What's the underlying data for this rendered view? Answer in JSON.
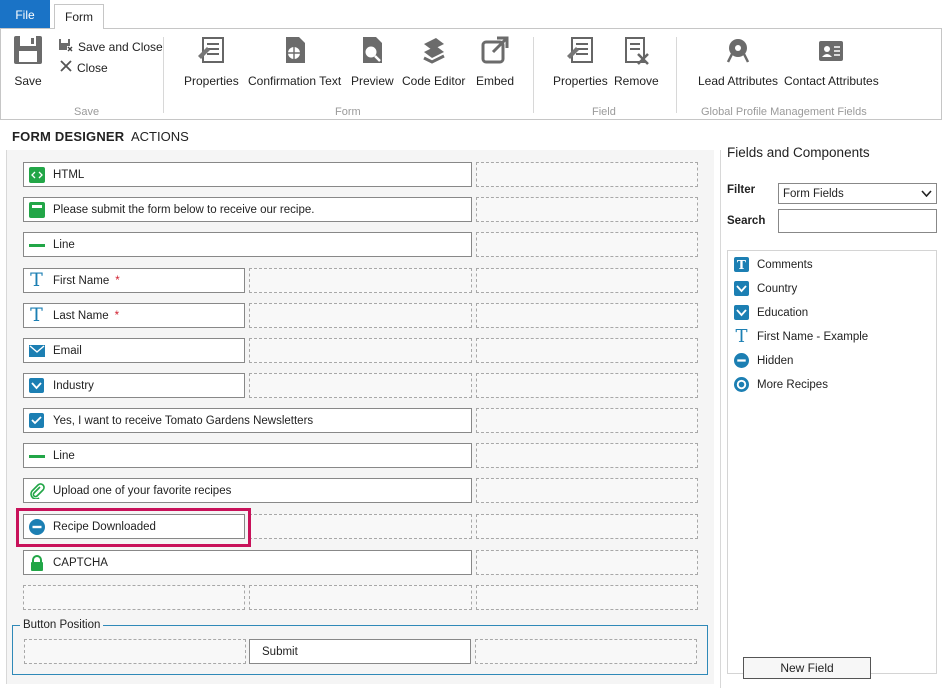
{
  "tabs": {
    "file": "File",
    "form": "Form"
  },
  "ribbon": {
    "save": "Save",
    "save_and_close": "Save and Close",
    "close": "Close",
    "group_save": "Save",
    "form_properties": "Properties",
    "confirmation_text": "Confirmation Text",
    "preview": "Preview",
    "code_editor": "Code Editor",
    "embed": "Embed",
    "group_form": "Form",
    "field_properties": "Properties",
    "remove": "Remove",
    "group_field": "Field",
    "lead_attributes": "Lead Attributes",
    "contact_attributes": "Contact Attributes",
    "group_global": "Global Profile Management Fields"
  },
  "designer": {
    "title": "FORM DESIGNER",
    "actions": "ACTIONS",
    "fields": [
      {
        "label": "HTML",
        "icon": "html-icon"
      },
      {
        "label": "Please submit the form below to receive our recipe.",
        "icon": "text-block-icon"
      },
      {
        "label": "Line",
        "icon": "line-icon"
      },
      {
        "label": "First Name",
        "icon": "text-field-icon",
        "required_mark": "*"
      },
      {
        "label": "Last Name",
        "icon": "text-field-icon",
        "required_mark": "*"
      },
      {
        "label": "Email",
        "icon": "email-icon"
      },
      {
        "label": "Industry",
        "icon": "dropdown-icon"
      },
      {
        "label": "Yes, I want to receive Tomato Gardens Newsletters",
        "icon": "checkbox-icon"
      },
      {
        "label": "Line",
        "icon": "line-icon"
      },
      {
        "label": "Upload one of your favorite recipes",
        "icon": "attachment-icon"
      },
      {
        "label": "Recipe Downloaded",
        "icon": "hidden-field-icon"
      },
      {
        "label": "CAPTCHA",
        "icon": "lock-icon"
      }
    ],
    "button_position_label": "Button Position",
    "submit_label": "Submit"
  },
  "panel": {
    "title": "Fields and Components",
    "filter_label": "Filter",
    "filter_value": "Form Fields",
    "search_label": "Search",
    "search_value": "",
    "items": [
      {
        "label": "Comments",
        "icon": "text-area-icon"
      },
      {
        "label": "Country",
        "icon": "dropdown-icon"
      },
      {
        "label": "Education",
        "icon": "dropdown-icon"
      },
      {
        "label": "First Name - Example",
        "icon": "text-field-icon"
      },
      {
        "label": "Hidden",
        "icon": "hidden-field-icon"
      },
      {
        "label": "More Recipes",
        "icon": "radio-icon"
      }
    ],
    "new_field": "New Field"
  },
  "colors": {
    "accent_blue": "#1a73c6",
    "field_green": "#22a647",
    "field_blue": "#1c7fb3",
    "highlight": "#c8125a"
  }
}
